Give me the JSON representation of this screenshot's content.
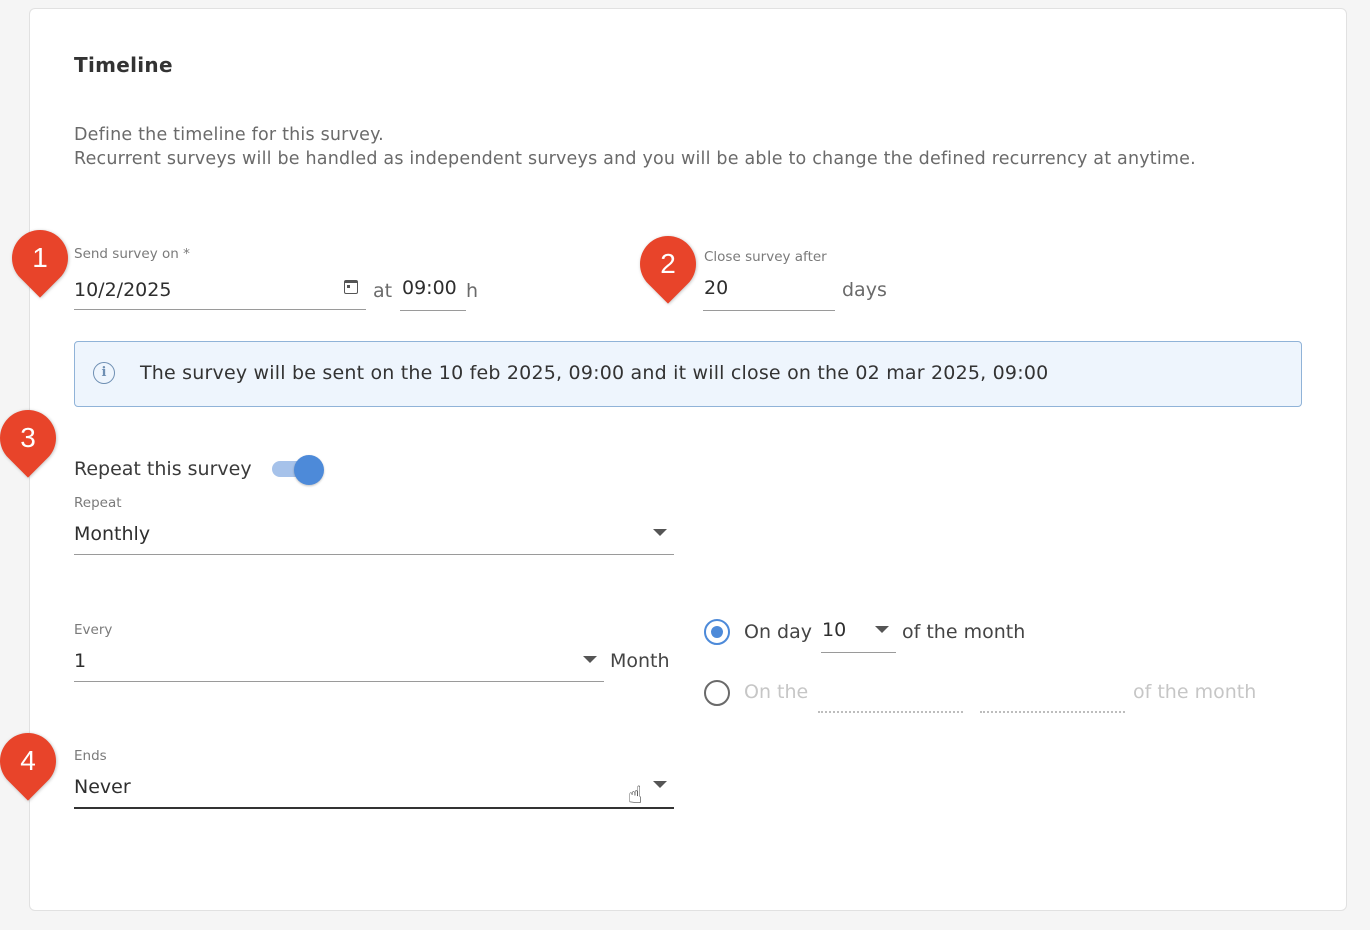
{
  "section": {
    "title": "Timeline",
    "description_line1": "Define the timeline for this survey.",
    "description_line2": "Recurrent surveys will be handled as independent surveys and you will be able to change the defined recurrency at anytime."
  },
  "send": {
    "label": "Send survey on *",
    "date": "10/2/2025",
    "at_label": "at",
    "time": "09:00",
    "time_unit": "h",
    "calendar_icon": "calendar-icon"
  },
  "close": {
    "label": "Close survey after",
    "value": "20",
    "unit": "days"
  },
  "info": {
    "icon": "info-icon",
    "icon_glyph": "i",
    "text": "The survey will be sent on the 10 feb 2025, 09:00 and it will close on the 02 mar 2025, 09:00"
  },
  "repeat": {
    "toggle_label": "Repeat this survey",
    "toggle_on": true,
    "select_label": "Repeat",
    "select_value": "Monthly"
  },
  "every": {
    "label": "Every",
    "value": "1",
    "unit": "Month"
  },
  "monthly_options": {
    "option1_prefix": "On day",
    "option1_day": "10",
    "option1_suffix": "of the month",
    "option1_selected": true,
    "option2_prefix": "On the",
    "option2_suffix": "of the month",
    "option2_selected": false
  },
  "ends": {
    "label": "Ends",
    "value": "Never"
  },
  "markers": [
    "1",
    "2",
    "3",
    "4"
  ],
  "colors": {
    "accent": "#4d8ad9",
    "marker": "#e8442a",
    "info_bg": "#eef5fd",
    "info_border": "#90b3d8"
  }
}
